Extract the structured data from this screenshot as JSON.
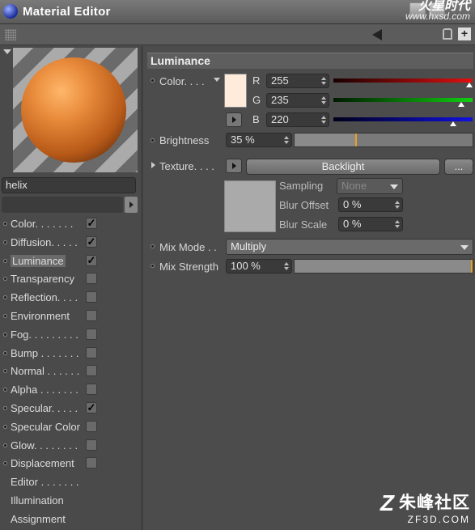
{
  "window": {
    "title": "Material Editor"
  },
  "watermark_top": {
    "brand": "火星时代",
    "url": "www.hxsd.com"
  },
  "material": {
    "name": "helix"
  },
  "channels": [
    {
      "label": "Color. . . . . . .",
      "checked": true,
      "has_checkbox": true
    },
    {
      "label": "Diffusion. . . . .",
      "checked": true,
      "has_checkbox": true
    },
    {
      "label": "Luminance",
      "checked": true,
      "has_checkbox": true,
      "selected": true
    },
    {
      "label": "Transparency",
      "checked": false,
      "has_checkbox": true
    },
    {
      "label": "Reflection. . . .",
      "checked": false,
      "has_checkbox": true
    },
    {
      "label": "Environment",
      "checked": false,
      "has_checkbox": true
    },
    {
      "label": "Fog. . . . . . . . .",
      "checked": false,
      "has_checkbox": true
    },
    {
      "label": "Bump . . . . . . .",
      "checked": false,
      "has_checkbox": true
    },
    {
      "label": "Normal . . . . . .",
      "checked": false,
      "has_checkbox": true
    },
    {
      "label": "Alpha . . . . . . .",
      "checked": false,
      "has_checkbox": true
    },
    {
      "label": "Specular. . . . .",
      "checked": true,
      "has_checkbox": true
    },
    {
      "label": "Specular Color",
      "checked": false,
      "has_checkbox": true
    },
    {
      "label": "Glow. . . . . . . .",
      "checked": false,
      "has_checkbox": true
    },
    {
      "label": "Displacement",
      "checked": false,
      "has_checkbox": true
    },
    {
      "label": "Editor . . . . . . .",
      "has_checkbox": false
    },
    {
      "label": "Illumination",
      "has_checkbox": false
    },
    {
      "label": "Assignment",
      "has_checkbox": false
    }
  ],
  "luminance": {
    "header": "Luminance",
    "color_label": "Color. . . .",
    "swatch_color": "#ffebdc",
    "r": {
      "letter": "R",
      "value": "255",
      "fraction": 1.0
    },
    "g": {
      "letter": "G",
      "value": "235",
      "fraction": 0.92
    },
    "b": {
      "letter": "B",
      "value": "220",
      "fraction": 0.86
    },
    "brightness_label": "Brightness",
    "brightness_value": "35 %",
    "brightness_fraction": 0.35,
    "texture_label": "Texture. . . .",
    "texture_name": "Backlight",
    "texture_more": "...",
    "sampling_label": "Sampling",
    "sampling_value": "None",
    "blur_offset_label": "Blur Offset",
    "blur_offset_value": "0 %",
    "blur_scale_label": "Blur Scale",
    "blur_scale_value": "0 %",
    "mix_mode_label": "Mix Mode . .",
    "mix_mode_value": "Multiply",
    "mix_strength_label": "Mix Strength",
    "mix_strength_value": "100 %",
    "mix_strength_fraction": 1.0
  },
  "watermark_bottom": {
    "cn": "朱峰社区",
    "en": "ZF3D.COM"
  },
  "colors": {
    "panel": "#4a4a4a",
    "accent": "#e8a020",
    "red": "#d01010",
    "green": "#10c010",
    "blue": "#1010d0"
  }
}
